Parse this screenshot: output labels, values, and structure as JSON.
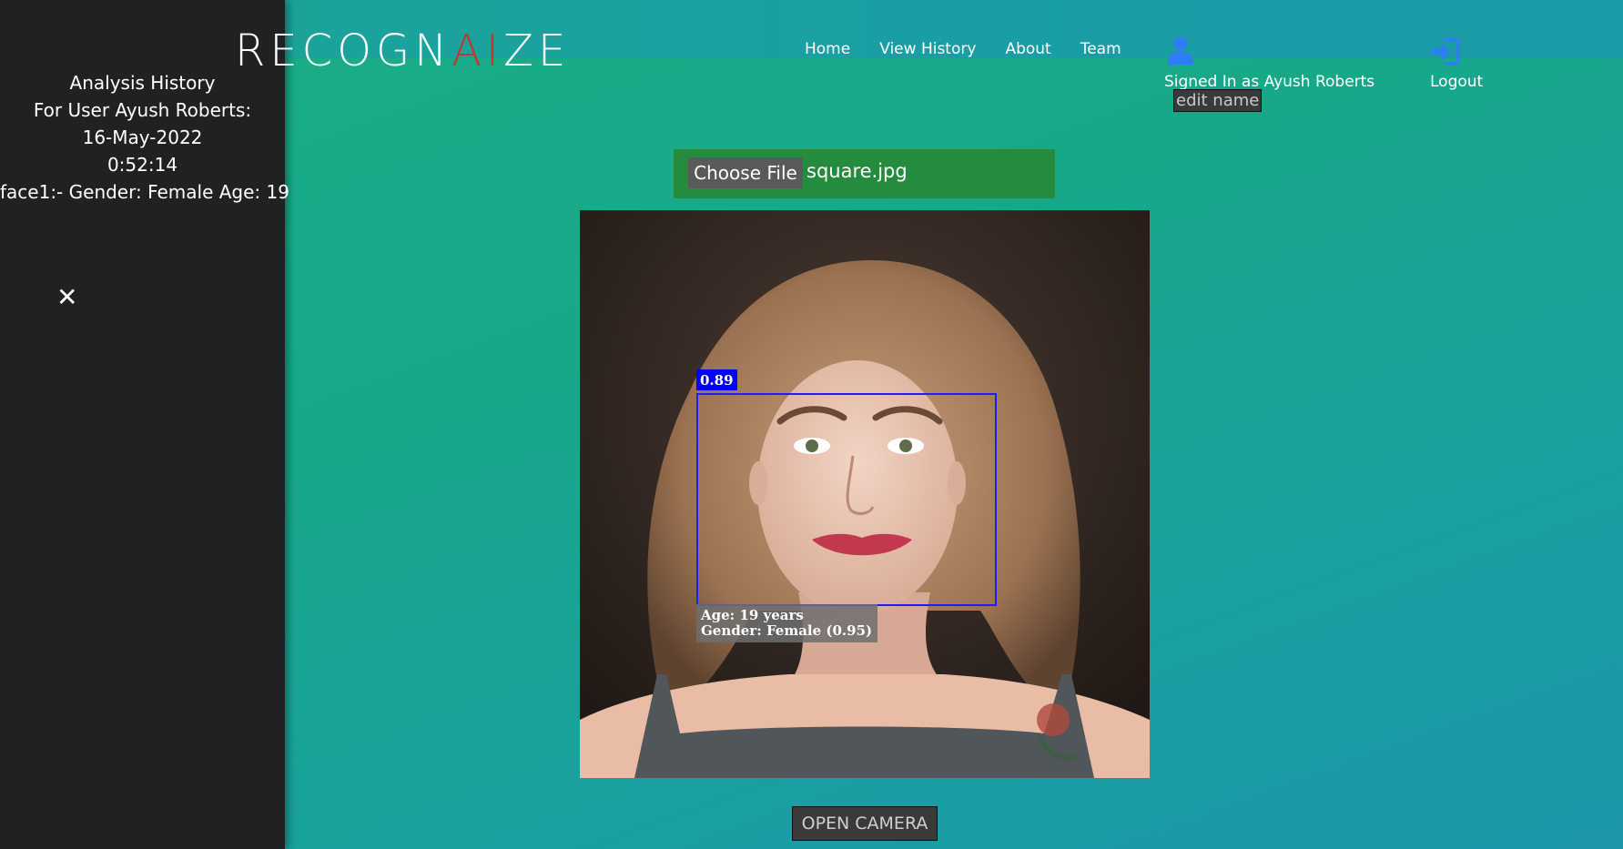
{
  "brand": {
    "logo_pre": "RECOGN",
    "logo_accent": "AI",
    "logo_post": "ZE",
    "accent_color": "#c0392b"
  },
  "nav": {
    "items": [
      "Home",
      "View History",
      "About",
      "Team"
    ]
  },
  "account": {
    "signed_in": "Signed In as Ayush Roberts",
    "edit_label": "edit name",
    "logout_label": "Logout",
    "user_icon": "user-icon",
    "logout_icon": "logout-icon"
  },
  "sidebar": {
    "heading": "Analysis History",
    "user_line": "For User Ayush Roberts:",
    "date": "16-May-2022",
    "time": "0:52:14",
    "face_line": "face1:- Gender: Female Age: 19",
    "close_icon": "close-icon"
  },
  "upload": {
    "button_label": "Choose File",
    "file_name": "square.jpg"
  },
  "result": {
    "confidence": "0.89",
    "age_text": "Age: 19 years",
    "gender_text": "Gender: Female (0.95)",
    "box_color": "#0000ff"
  },
  "camera": {
    "button_label": "OPEN CAMERA"
  }
}
